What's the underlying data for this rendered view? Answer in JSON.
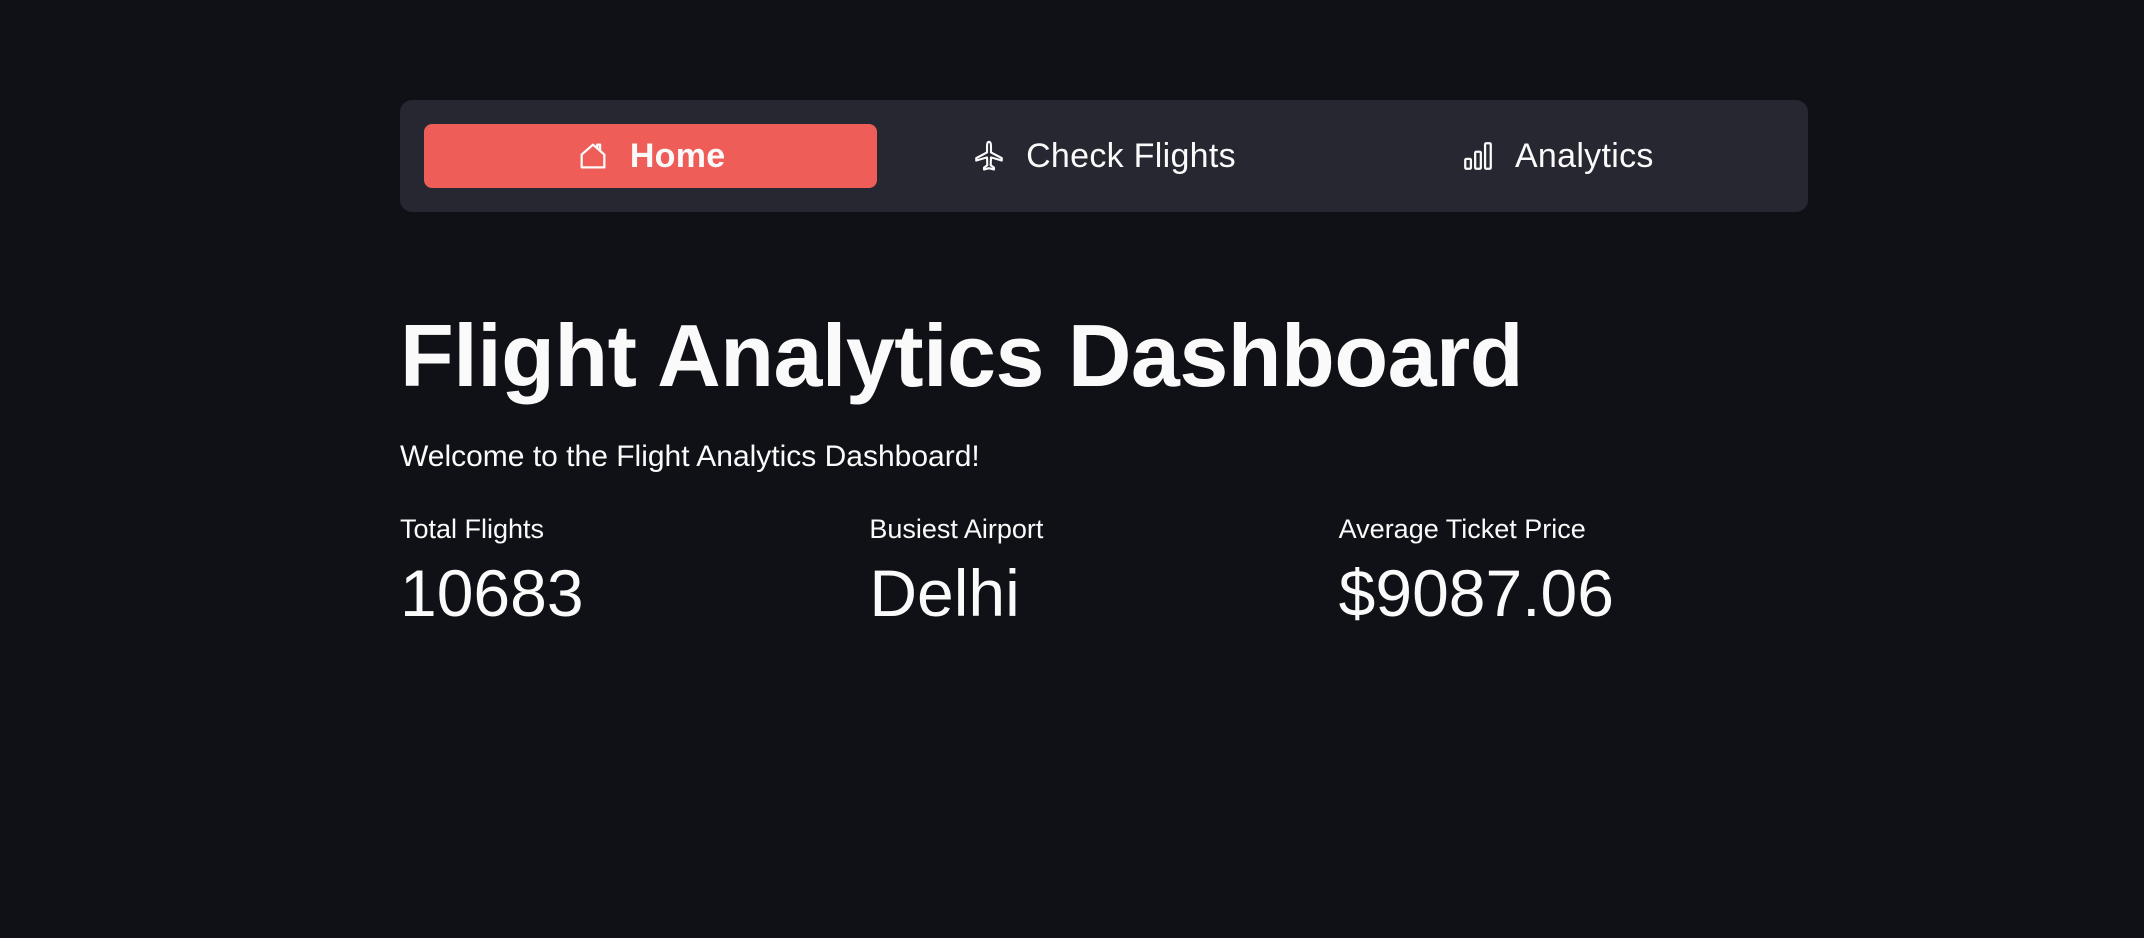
{
  "nav": {
    "items": [
      {
        "label": "Home",
        "icon": "home-icon",
        "active": true
      },
      {
        "label": "Check Flights",
        "icon": "airplane-icon",
        "active": false
      },
      {
        "label": "Analytics",
        "icon": "bar-chart-icon",
        "active": false
      }
    ]
  },
  "page": {
    "title": "Flight Analytics Dashboard",
    "welcome": "Welcome to the Flight Analytics Dashboard!"
  },
  "metrics": [
    {
      "label": "Total Flights",
      "value": "10683"
    },
    {
      "label": "Busiest Airport",
      "value": "Delhi"
    },
    {
      "label": "Average Ticket Price",
      "value": "$9087.06"
    }
  ],
  "colors": {
    "background": "#0f1116",
    "navbar": "#262730",
    "accent": "#ef5d58",
    "text": "#fafafa"
  }
}
